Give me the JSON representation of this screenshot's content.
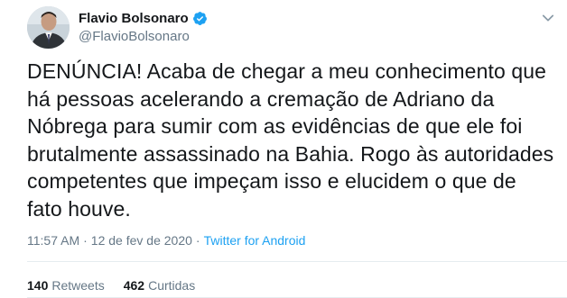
{
  "author": {
    "display_name": "Flavio Bolsonaro",
    "username": "@FlavioBolsonaro",
    "verified": true,
    "avatar_icon": "profile-photo"
  },
  "tweet": {
    "text": "DENÚNCIA! Acaba de chegar a meu conhecimento que\nhá pessoas acelerando a cremação de Adriano da\nNóbrega para sumir com as evidências de que ele foi\nbrutalmente assassinado na Bahia. Rogo às autoridades\ncompetentes que impeçam isso e elucidem o que de\nfato houve."
  },
  "meta": {
    "time": "11:57 AM",
    "separator1": "·",
    "date": "12 de fev de 2020",
    "separator2": "·",
    "source": "Twitter for Android"
  },
  "stats": {
    "retweets_count": "140",
    "retweets_label": "Retweets",
    "likes_count": "462",
    "likes_label": "Curtidas"
  },
  "colors": {
    "accent": "#1da1f2",
    "muted": "#657786",
    "text": "#14171a",
    "divider": "#e6ecf0"
  },
  "icons": {
    "verified": "verified-badge-icon",
    "menu": "chevron-down-icon"
  }
}
